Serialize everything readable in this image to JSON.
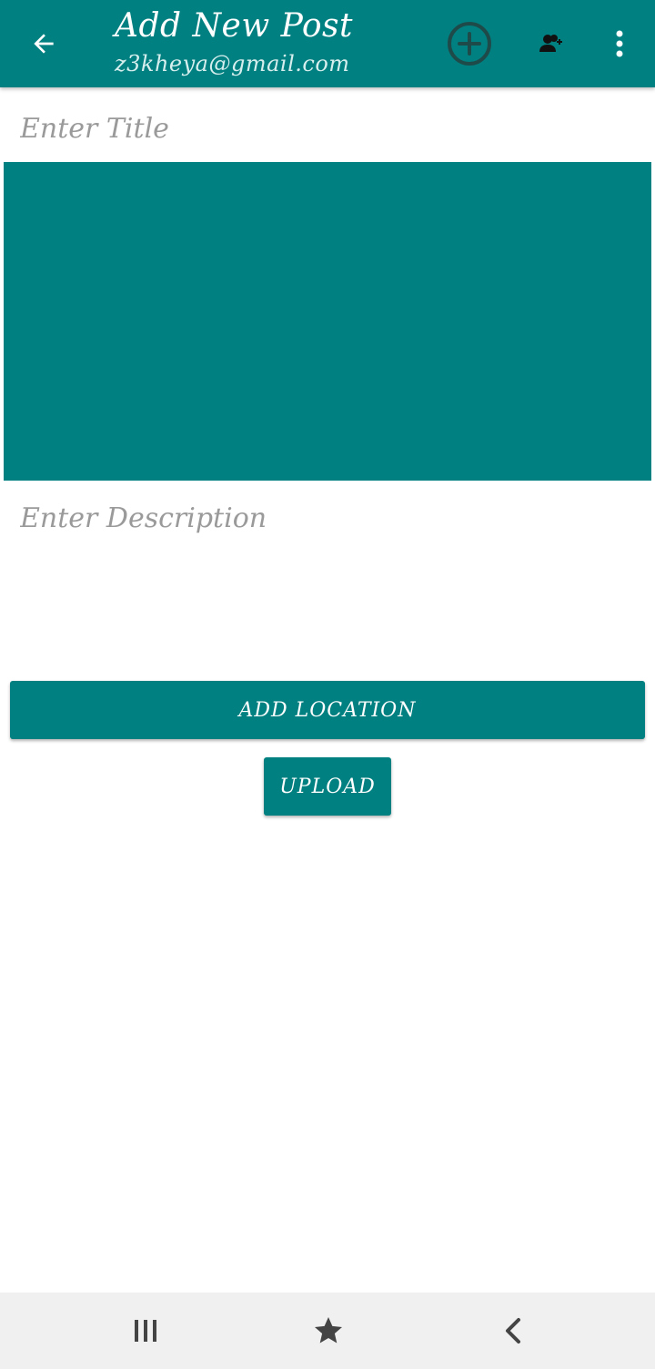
{
  "toolbar": {
    "title": "Add New Post",
    "subtitle": "z3kheya@gmail.com",
    "icons": [
      "back-arrow-icon",
      "add-circle-icon",
      "person-add-icon",
      "more-vertical-icon"
    ]
  },
  "form": {
    "title_placeholder": "Enter Title",
    "title_value": "",
    "description_placeholder": "Enter Description",
    "description_value": "",
    "add_location_label": "ADD LOCATION",
    "upload_label": "UPLOAD"
  },
  "navbar": {
    "icons": [
      "recents-icon",
      "home-star-icon",
      "back-chevron-icon"
    ]
  },
  "colors": {
    "primary": "#008080",
    "navbar_bg": "#f0f0f0",
    "placeholder": "#9a9a9a"
  }
}
